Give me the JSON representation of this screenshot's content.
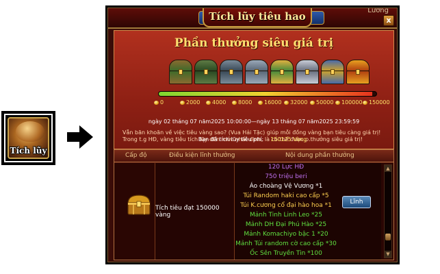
{
  "event_icon": {
    "label": "Tích lũy",
    "icon": "gold-bag-icon"
  },
  "arrow_icon": "right-arrow-icon",
  "window": {
    "title": "Tích lũy tiêu hao",
    "corner_text": "Lương",
    "close_label": "x"
  },
  "rewards": {
    "heading": "Phần thưởng siêu giá trị",
    "progress": 0.98,
    "chests": [
      {
        "color": "#8a6a30",
        "accent": "#3f6a2a"
      },
      {
        "color": "#5e7a44",
        "accent": "#2a4a22"
      },
      {
        "color": "#7a8a98",
        "accent": "#3a4a58"
      },
      {
        "color": "#9aa8b8",
        "accent": "#5a6878"
      },
      {
        "color": "#e0b040",
        "accent": "#4a8a3a"
      },
      {
        "color": "#c8ccd6",
        "accent": "#6a7080"
      },
      {
        "color": "#4a6aa8",
        "accent": "#c8a030"
      },
      {
        "color": "#e8a020",
        "accent": "#b04010"
      }
    ],
    "milestones": [
      "0",
      "2000",
      "4000",
      "8000",
      "16000",
      "32000",
      "50000",
      "100000",
      "150000"
    ]
  },
  "event_period": "ngày 02 tháng 07 năm2025 10:00:00—ngày 13 tháng 07 năm2025 23:59:59",
  "description": "Vẫn băn khoăn về việc tiêu vàng sao? (Vua Hải Tặc) giúp mỗi đồng vàng bạn tiêu càng giá trị! Trong t.g HĐ, vàng tiêu tích lũy đến mức nhất định, là có thể được p.thưởng siêu giá trị!",
  "accumulated": {
    "label": "Bạn đã tích lũy tiêu phí:",
    "value": "150125 Vàng"
  },
  "table": {
    "headers": {
      "level": "Cấp độ",
      "condition": "Điều kiện lĩnh thưởng",
      "content": "Nội dung phần thưởng"
    },
    "row": {
      "condition": "Tích tiêu đạt 150000 vàng",
      "claim_label": "Lĩnh",
      "items": [
        {
          "text": "120 Lực HĐ",
          "color": "#c070f0"
        },
        {
          "text": "750 triệu beri",
          "color": "#c070f0"
        },
        {
          "text": "Áo choàng Vệ Vương *1",
          "color": "#ffffff"
        },
        {
          "text": "Túi Random haki cao cấp *5",
          "color": "#ffd050"
        },
        {
          "text": "Túi K.cương cổ đại hào hoa *1",
          "color": "#ffd050"
        },
        {
          "text": "Mảnh Tinh Linh Leo *25",
          "color": "#60e040"
        },
        {
          "text": "Mảnh DH Đại Phú Hào *25",
          "color": "#60e040"
        },
        {
          "text": "Mảnh Komachiyo bậc 1 *20",
          "color": "#60e040"
        },
        {
          "text": "Mảnh Túi random cờ cao cấp *30",
          "color": "#60e040"
        },
        {
          "text": "Ốc Sên Truyền Tin *100",
          "color": "#60e040"
        }
      ]
    }
  }
}
